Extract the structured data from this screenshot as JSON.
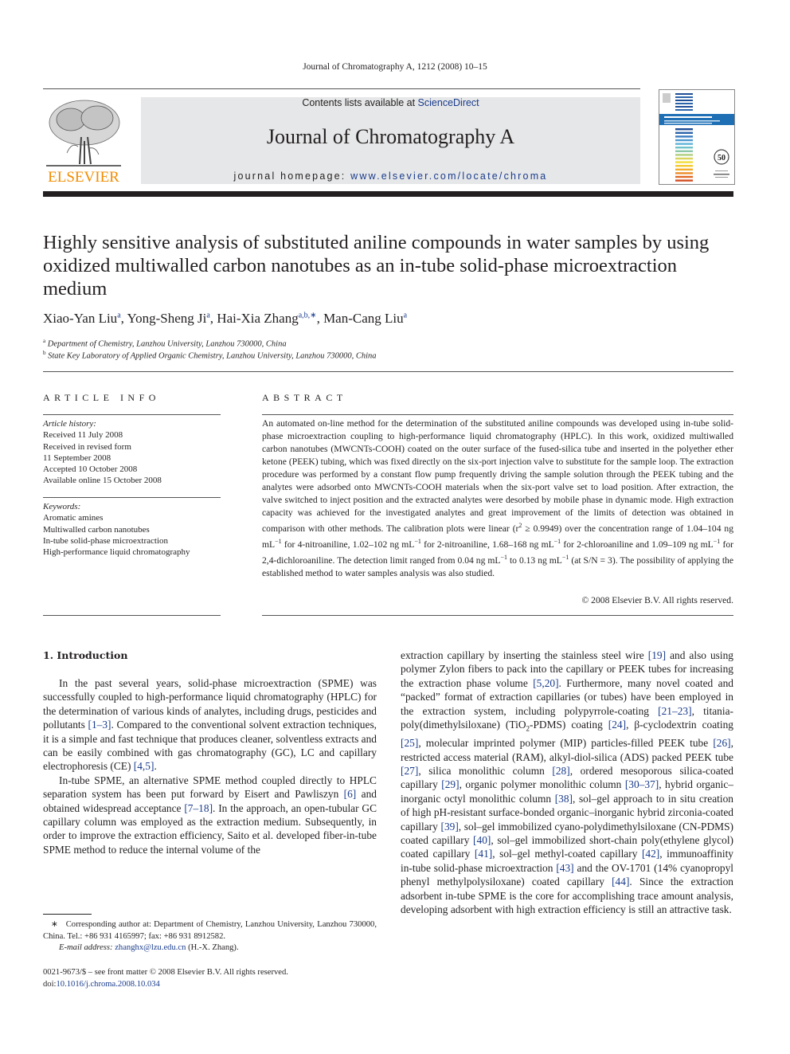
{
  "running_head": "Journal of Chromatography A, 1212 (2008) 10–15",
  "publisher": {
    "logo_text": "ELSEVIER",
    "logo_color": "#f28c00"
  },
  "banner": {
    "contents_prefix": "Contents lists available at ",
    "contents_link": "ScienceDirect",
    "journal_title": "Journal of Chromatography A",
    "homepage_prefix": "journal homepage: ",
    "homepage_link": "www.elsevier.com/locate/chroma",
    "background": "#e6e7e8",
    "link_color": "#1a3c8c"
  },
  "cover": {
    "badge": "50",
    "stripe_colors": [
      "#1f4e96",
      "#2a63aa",
      "#3a7cc0",
      "#4f9ad0",
      "#5fb3d9",
      "#6fc2c9",
      "#8cc8a8",
      "#b0cf7f",
      "#d8d45c",
      "#f2dd3a",
      "#f6c92f",
      "#f3ad2a",
      "#ec8c28",
      "#e06a25",
      "#d24e22"
    ]
  },
  "article": {
    "title": "Highly sensitive analysis of substituted aniline compounds in water samples by using oxidized multiwalled carbon nanotubes as an in-tube solid-phase microextraction medium",
    "authors": [
      {
        "name": "Xiao-Yan Liu",
        "sup": "a",
        "sep": ", "
      },
      {
        "name": "Yong-Sheng Ji",
        "sup": "a",
        "sep": ", "
      },
      {
        "name": "Hai-Xia Zhang",
        "sup": "a,b,∗",
        "sep": ", "
      },
      {
        "name": "Man-Cang Liu",
        "sup": "a",
        "sep": ""
      }
    ],
    "affiliations": [
      {
        "mark": "a",
        "text": "Department of Chemistry, Lanzhou University, Lanzhou 730000, China"
      },
      {
        "mark": "b",
        "text": "State Key Laboratory of Applied Organic Chemistry, Lanzhou University, Lanzhou 730000, China"
      }
    ]
  },
  "article_info": {
    "heading": "ARTICLE INFO",
    "history_label": "Article history:",
    "history": [
      "Received 11 July 2008",
      "Received in revised form",
      "11 September 2008",
      "Accepted 10 October 2008",
      "Available online 15 October 2008"
    ],
    "keywords_label": "Keywords:",
    "keywords": [
      "Aromatic amines",
      "Multiwalled carbon nanotubes",
      "In-tube solid-phase microextraction",
      "High-performance liquid chromatography"
    ]
  },
  "abstract": {
    "heading": "ABSTRACT",
    "p1": "An automated on-line method for the determination of the substituted aniline compounds was developed using in-tube solid-phase microextraction coupling to high-performance liquid chromatography (HPLC). In this work, oxidized multiwalled carbon nanotubes (MWCNTs-COOH) coated on the outer surface of the fused-silica tube and inserted in the polyether ether ketone (PEEK) tubing, which was fixed directly on the six-port injection valve to substitute for the sample loop. The extraction procedure was performed by a constant flow pump frequently driving the sample solution through the PEEK tubing and the analytes were adsorbed onto MWCNTs-COOH materials when the six-port valve set to load position. After extraction, the valve switched to inject position and the extracted analytes were desorbed by mobile phase in dynamic mode. High extraction capacity was achieved for the investigated analytes and great improvement of the limits of detection was obtained in comparison with other methods. The calibration plots were linear (r",
    "r2_sup": "2",
    "p2": " ≥ 0.9949) over the concentration range of 1.04–104 ng mL",
    "unit_sup": "−1",
    "p3": " for 4-nitroaniline, 1.02–102 ng mL",
    "p4": " for 2-nitroaniline, 1.68–168 ng mL",
    "p5": " for 2-chloroaniline and 1.09–109 ng mL",
    "p6": " for 2,4-dichloroaniline. The detection limit ranged from 0.04 ng mL",
    "p7": " to 0.13 ng mL",
    "p8": " (at S/N = 3). The possibility of applying the established method to water samples analysis was also studied.",
    "copyright": "© 2008 Elsevier B.V. All rights reserved."
  },
  "introduction": {
    "heading": "1.  Introduction",
    "para1": [
      {
        "t": "In the past several years, solid-phase microextraction (SPME) was successfully coupled to high-performance liquid chromatography (HPLC) for the determination of various kinds of analytes, including drugs, pesticides and pollutants "
      },
      {
        "ref": "[1–3]"
      },
      {
        "t": ". Compared to the conventional solvent extraction techniques, it is a simple and fast technique that produces cleaner, solventless extracts and can be easily combined with gas chromatography (GC), LC and capillary electrophoresis (CE) "
      },
      {
        "ref": "[4,5]"
      },
      {
        "t": "."
      }
    ],
    "para2": [
      {
        "t": "In-tube SPME, an alternative SPME method coupled directly to HPLC separation system has been put forward by Eisert and Pawliszyn "
      },
      {
        "ref": "[6]"
      },
      {
        "t": " and obtained widespread acceptance "
      },
      {
        "ref": "[7–18]"
      },
      {
        "t": ". In the approach, an open-tubular GC capillary column was employed as the extraction medium. Subsequently, in order to improve the extraction efficiency, Saito et al. developed fiber-in-tube SPME method to reduce the internal volume of the"
      }
    ],
    "para3": [
      {
        "t": "extraction capillary by inserting the stainless steel wire "
      },
      {
        "ref": "[19]"
      },
      {
        "t": " and also using polymer Zylon fibers to pack into the capillary or PEEK tubes for increasing the extraction phase volume "
      },
      {
        "ref": "[5,20]"
      },
      {
        "t": ". Furthermore, many novel coated and “packed” format of extraction capillaries (or tubes) have been employed in the extraction system, including polypyrrole-coating "
      },
      {
        "ref": "[21–23]"
      },
      {
        "t": ", titania-poly(dimethylsiloxane) (TiO"
      },
      {
        "sub": "2"
      },
      {
        "t": "-PDMS) coating "
      },
      {
        "ref": "[24]"
      },
      {
        "t": ", β-cyclodextrin coating "
      },
      {
        "ref": "[25]"
      },
      {
        "t": ", molecular imprinted polymer (MIP) particles-filled PEEK tube "
      },
      {
        "ref": "[26]"
      },
      {
        "t": ", restricted access material (RAM), alkyl-diol-silica (ADS) packed PEEK tube "
      },
      {
        "ref": "[27]"
      },
      {
        "t": ", silica monolithic column "
      },
      {
        "ref": "[28]"
      },
      {
        "t": ", ordered mesoporous silica-coated capillary "
      },
      {
        "ref": "[29]"
      },
      {
        "t": ", organic polymer monolithic column "
      },
      {
        "ref": "[30–37]"
      },
      {
        "t": ", hybrid organic–inorganic octyl monolithic column "
      },
      {
        "ref": "[38]"
      },
      {
        "t": ", sol–gel approach to in situ creation of high pH-resistant surface-bonded organic–inorganic hybrid zirconia-coated capillary "
      },
      {
        "ref": "[39]"
      },
      {
        "t": ", sol–gel immobilized cyano-polydimethylsiloxane (CN-PDMS) coated capillary "
      },
      {
        "ref": "[40]"
      },
      {
        "t": ", sol–gel immobilized short-chain poly(ethylene glycol) coated capillary "
      },
      {
        "ref": "[41]"
      },
      {
        "t": ", sol–gel methyl-coated capillary "
      },
      {
        "ref": "[42]"
      },
      {
        "t": ", immunoaffinity in-tube solid-phase microextraction "
      },
      {
        "ref": "[43]"
      },
      {
        "t": " and the OV-1701 (14% cyanopropyl phenyl methylpolysiloxane) coated capillary "
      },
      {
        "ref": "[44]"
      },
      {
        "t": ". Since the extraction adsorbent in-tube SPME is the core for accomplishing trace amount analysis, developing adsorbent with high extraction efficiency is still an attractive task."
      }
    ]
  },
  "footnote": {
    "mark": "∗",
    "corresponding": "Corresponding author at: Department of Chemistry, Lanzhou University, Lanzhou 730000, China. Tel.: +86 931 4165997; fax: +86 931 8912582.",
    "email_label": "E-mail address:",
    "email": "zhanghx@lzu.edu.cn",
    "email_suffix": " (H.-X. Zhang)."
  },
  "issn_line": "0021-9673/$ – see front matter © 2008 Elsevier B.V. All rights reserved.",
  "doi_prefix": "doi:",
  "doi": "10.1016/j.chroma.2008.10.034"
}
